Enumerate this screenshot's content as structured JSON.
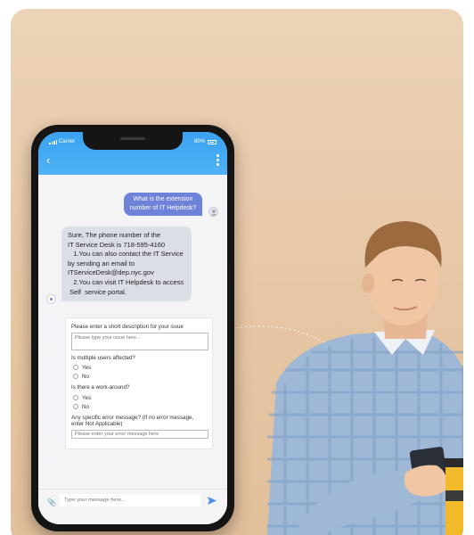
{
  "status": {
    "carrier": "Carrier",
    "battery": "80%"
  },
  "chat": {
    "user_message": "What is the extension number of IT Helpdesk?",
    "bot_lines": [
      "Sure, The phone number of the",
      "IT Service Desk is 718-595-4160",
      "   1.You can also contact the IT Service",
      "by sending an email to",
      "ITServiceDesk@dep.nyc.gov",
      "   2.You can visit IT Helpdesk to access",
      " Self  service portal."
    ]
  },
  "form": {
    "q1": "Please enter a short description for your issue",
    "q1_placeholder": "Please type your issue here...",
    "q2": "Is multiple users affected?",
    "q2_yes": "Yes",
    "q2_no": "No",
    "q3": "Is there a work-around?",
    "q3_yes": "Yes",
    "q3_no": "No",
    "q4_line1": "Any specific error message? (If no error message,",
    "q4_line2": "enter Not Applicable)",
    "q4_placeholder": "Please enter your error message here"
  },
  "composer": {
    "placeholder": "Type your message here..."
  },
  "colors": {
    "background": "#e6c6a4",
    "header": "#3aa2f2",
    "user_bubble": "#6f82d9",
    "bot_bubble": "#dcdee7"
  },
  "icons": [
    "signal-icon",
    "battery-icon",
    "back-arrow-icon",
    "kebab-menu-icon",
    "user-avatar-icon",
    "bot-avatar-icon",
    "paperclip-icon",
    "send-icon"
  ]
}
